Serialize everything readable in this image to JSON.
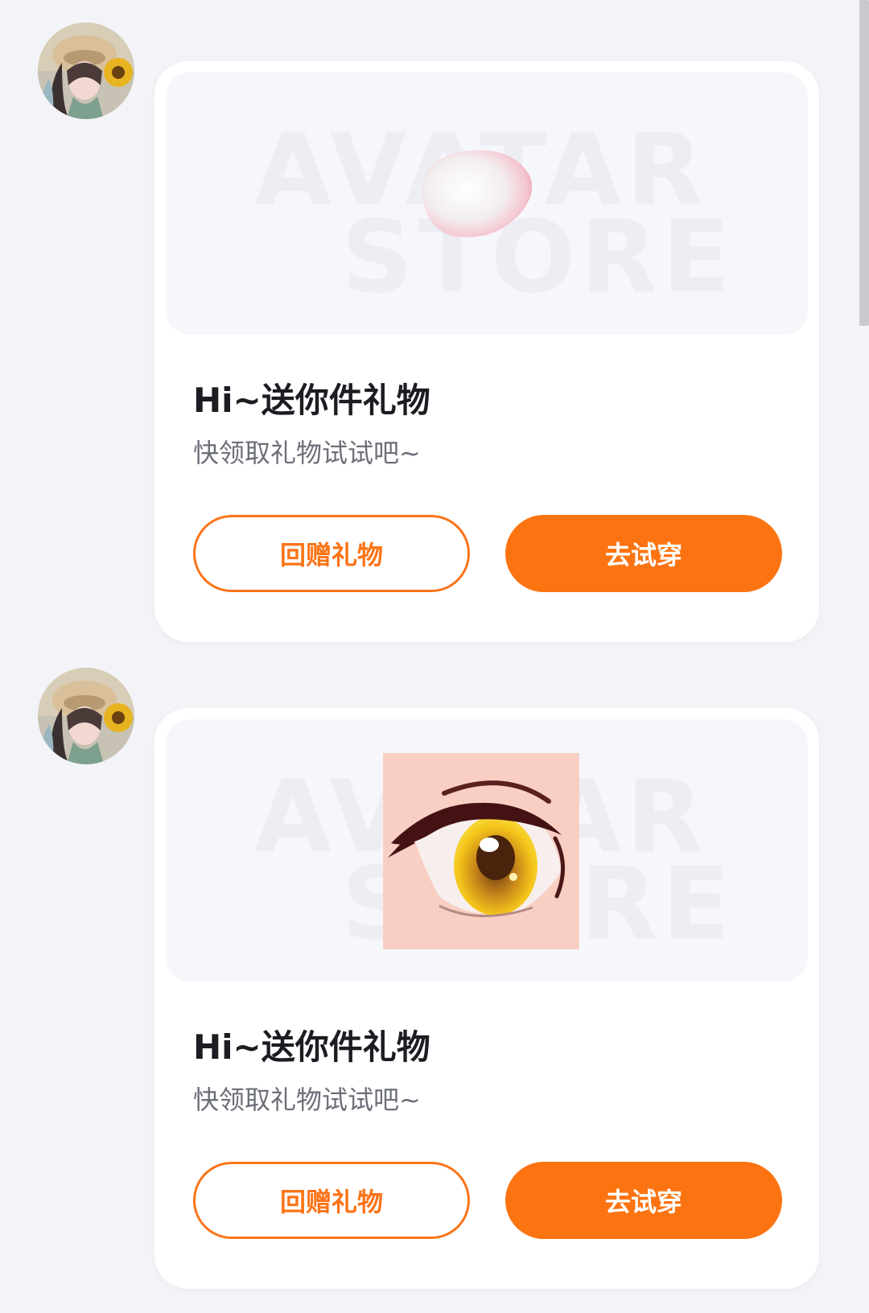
{
  "watermark": {
    "line1": "AVATAR",
    "line2": "STORE"
  },
  "messages": [
    {
      "item_type": "petal",
      "title": "Hi~送你件礼物",
      "subtitle": "快领取礼物试试吧~",
      "return_gift_label": "回赠礼物",
      "try_on_label": "去试穿"
    },
    {
      "item_type": "eye",
      "title": "Hi~送你件礼物",
      "subtitle": "快领取礼物试试吧~",
      "return_gift_label": "回赠礼物",
      "try_on_label": "去试穿"
    }
  ],
  "colors": {
    "accent": "#fc7412",
    "background": "#f3f4f8",
    "card": "#ffffff"
  }
}
